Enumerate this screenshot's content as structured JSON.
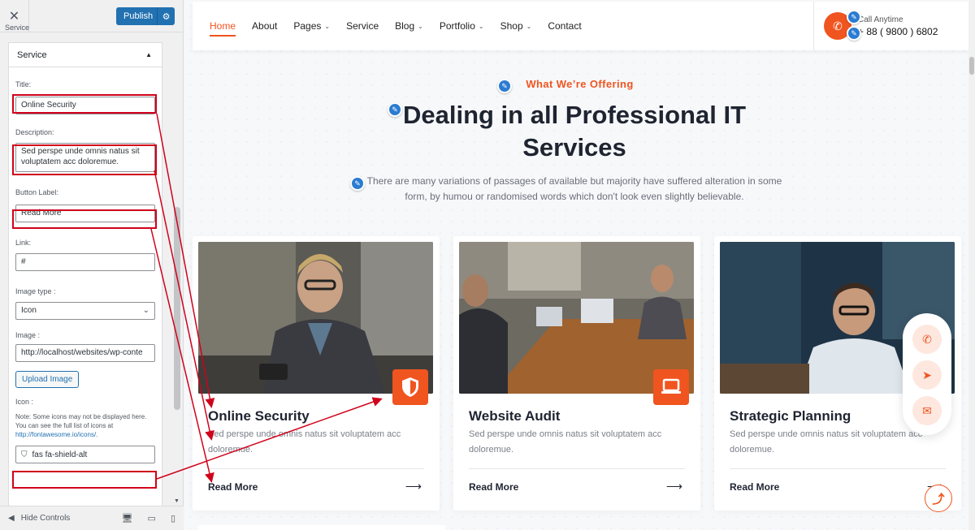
{
  "customizer": {
    "close_icon": "close-icon",
    "publish_label": "Publish",
    "breadcrumb": "Service",
    "panel_title": "Service",
    "fields": {
      "title_label": "Title:",
      "title_value": "Online Security",
      "description_label": "Description:",
      "description_value": "Sed perspe unde omnis natus sit voluptatem acc doloremue.",
      "button_label_label": "Button Label:",
      "button_label_value": "Read More",
      "link_label": "Link:",
      "link_value": "#",
      "image_type_label": "Image type :",
      "image_type_value": "Icon",
      "image_label": "Image :",
      "image_value": "http://localhost/websites/wp-conte",
      "upload_button": "Upload Image",
      "icon_label": "Icon :",
      "icon_note": "Note: Some icons may not be displayed here. You can see the full list of icons at",
      "icon_note_link": "http://fontawesome.io/icons/",
      "icon_note_end": ".",
      "icon_value": "fas fa-shield-alt"
    },
    "footer": {
      "hide_controls": "Hide Controls"
    }
  },
  "site": {
    "nav": [
      {
        "label": "Home",
        "dropdown": false,
        "active": true
      },
      {
        "label": "About",
        "dropdown": false
      },
      {
        "label": "Pages",
        "dropdown": true
      },
      {
        "label": "Service",
        "dropdown": false
      },
      {
        "label": "Blog",
        "dropdown": true
      },
      {
        "label": "Portfolio",
        "dropdown": true
      },
      {
        "label": "Shop",
        "dropdown": true
      },
      {
        "label": "Contact",
        "dropdown": false
      }
    ],
    "call_label": "Call Anytime",
    "call_number": "+ 88 ( 9800 ) 6802",
    "section_subtitle": "What We’re Offering",
    "section_title": "Dealing in all Professional IT Services",
    "section_desc": "There are many variations of passages of available but majority have suffered alteration in some form, by humou or randomised words which don't look even slightly believable.",
    "cards": [
      {
        "title": "Online Security",
        "desc": "Sed perspe unde omnis natus sit voluptatem acc doloremue.",
        "cta": "Read More",
        "icon": "shield-icon"
      },
      {
        "title": "Website Audit",
        "desc": "Sed perspe unde omnis natus sit voluptatem acc doloremue.",
        "cta": "Read More",
        "icon": "laptop-icon"
      },
      {
        "title": "Strategic Planning",
        "desc": "Sed perspe unde omnis natus sit voluptatem acc doloremue.",
        "cta": "Read More",
        "icon": "chart-icon"
      }
    ],
    "colors": {
      "accent": "#f0541f",
      "edit_blue": "#2b7bd1",
      "wp_blue": "#2271b1",
      "highlight": "#d0021b"
    }
  }
}
